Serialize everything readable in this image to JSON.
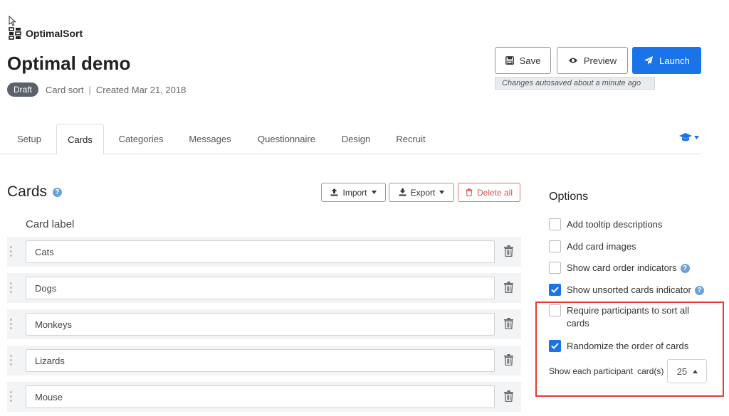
{
  "brand": {
    "name": "OptimalSort"
  },
  "study": {
    "title": "Optimal demo",
    "status": "Draft",
    "type": "Card sort",
    "separator": "|",
    "created": "Created Mar 21, 2018"
  },
  "toolbar": {
    "save_label": "Save",
    "preview_label": "Preview",
    "launch_label": "Launch",
    "autosave_text": "Changes autosaved about a minute ago"
  },
  "tabs": [
    {
      "label": "Setup"
    },
    {
      "label": "Cards",
      "active": true
    },
    {
      "label": "Categories"
    },
    {
      "label": "Messages"
    },
    {
      "label": "Questionnaire"
    },
    {
      "label": "Design"
    },
    {
      "label": "Recruit"
    }
  ],
  "cards_section": {
    "heading": "Cards",
    "help_icon": "question-circle-icon",
    "import_label": "Import",
    "export_label": "Export",
    "delete_all_label": "Delete all",
    "column_label": "Card label",
    "cards": [
      "Cats",
      "Dogs",
      "Monkeys",
      "Lizards",
      "Mouse"
    ]
  },
  "options": {
    "title": "Options",
    "items": [
      {
        "label": "Add tooltip descriptions",
        "checked": false
      },
      {
        "label": "Add card images",
        "checked": false
      },
      {
        "label": "Show card order indicators",
        "checked": false,
        "help": true
      },
      {
        "label": "Show unsorted cards indicator",
        "checked": true,
        "help": true
      },
      {
        "label_line1": "Require participants to sort all",
        "label_line2": "cards",
        "checked": false
      },
      {
        "label": "Randomize the order of cards",
        "checked": true
      }
    ],
    "count_prefix": "Show each participant",
    "count_suffix": "card(s)",
    "count_value": "25"
  },
  "colors": {
    "accent": "#1a73e8",
    "draft_badge": "#59616b",
    "delete": "#d9534f",
    "highlight": "#e53935"
  }
}
